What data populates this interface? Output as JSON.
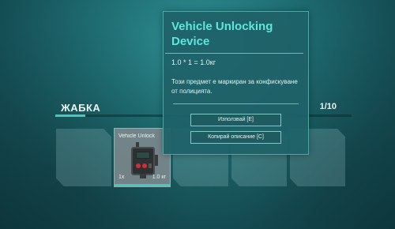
{
  "inventory": {
    "title": "ЖАБКА",
    "count": "1/10",
    "fill_fraction": 0.1,
    "slots": [
      {
        "name": "",
        "qty": "",
        "weight": ""
      },
      {
        "name": "Vehicle Unlock",
        "qty": "1x",
        "weight": "1.0 кг"
      },
      {
        "name": "",
        "qty": "",
        "weight": ""
      },
      {
        "name": "",
        "qty": "",
        "weight": ""
      },
      {
        "name": "",
        "qty": "",
        "weight": ""
      }
    ]
  },
  "tooltip": {
    "title": "Vehicle Unlocking Device",
    "weight_formula": "1.0 * 1 = 1.0кг",
    "description": "Този предмет е маркиран за конфискуване от полицията.",
    "use_button": "Използвай [E]",
    "copy_button": "Копирай описание [C]"
  },
  "colors": {
    "accent": "#45c8c0",
    "title": "#5fe6dc"
  }
}
